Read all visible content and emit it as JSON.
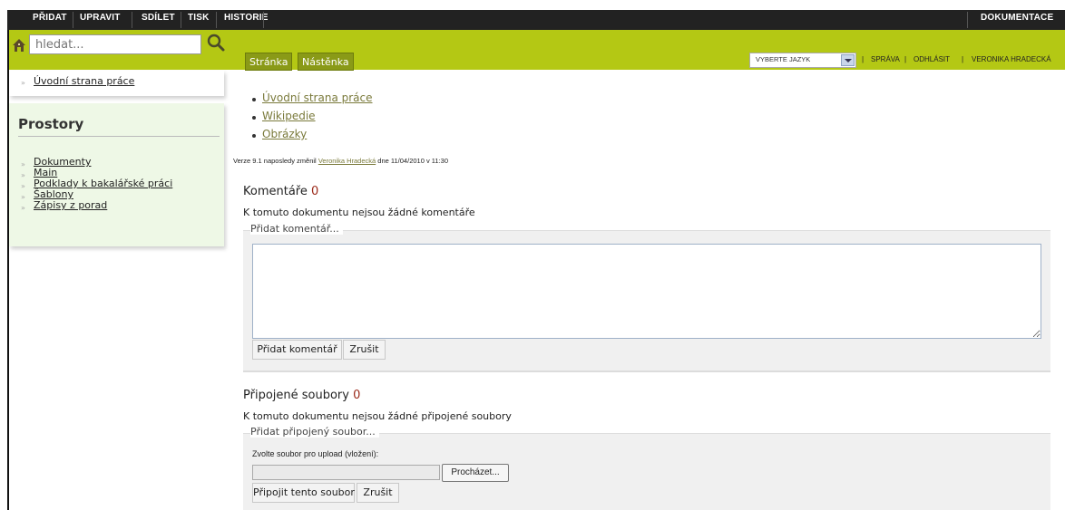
{
  "topmenu": {
    "items": [
      "PŘIDAT",
      "UPRAVIT",
      "SDÍLET",
      "TISK",
      "HISTORIE"
    ],
    "documentation": "DOKUMENTACE"
  },
  "search": {
    "placeholder": "hledat..."
  },
  "tabs": [
    "Stránka",
    "Nástěnka"
  ],
  "language": {
    "selected": "VYBERTE JAZYK"
  },
  "user_links": {
    "sprava": "SPRÁVA",
    "logout": "ODHLÁSIT",
    "user": "VERONIKA HRADECKÁ",
    "sep": "|"
  },
  "sidebar": {
    "home_link": "Úvodní strana práce",
    "spaces_title": "Prostory",
    "spaces": [
      "Dokumenty",
      "Main",
      "Podklady k bakalářské práci",
      "Šablony",
      "Zápisy z porad"
    ]
  },
  "main": {
    "links": [
      "Úvodní strana práce",
      "Wikipedie",
      "Obrázky"
    ],
    "version": {
      "prefix": "Verze 9.1 naposledy změnil",
      "author": "Veronika Hradecká",
      "suffix": "dne 11/04/2010 v 11:30"
    },
    "comments": {
      "title": "Komentáře",
      "count": "0",
      "empty_text": "K tomuto dokumentu nejsou žádné komentáře",
      "legend": "Přidat komentář...",
      "submit": "Přidat komentář",
      "cancel": "Zrušit"
    },
    "attachments": {
      "title": "Připojené soubory",
      "count": "0",
      "empty_text": "K tomuto dokumentu nejsou žádné připojené soubory",
      "legend": "Přidat připojený soubor...",
      "upload_label": "Zvolte soubor pro upload (vložení):",
      "browse": "Procházet...",
      "submit": "Připojit tento soubor",
      "cancel": "Zrušit"
    }
  },
  "colors": {
    "accent_green": "#b4c814",
    "tab_green": "#8a9a17",
    "count_red": "#9b2a1a",
    "link_olive": "#7a7a3b"
  }
}
